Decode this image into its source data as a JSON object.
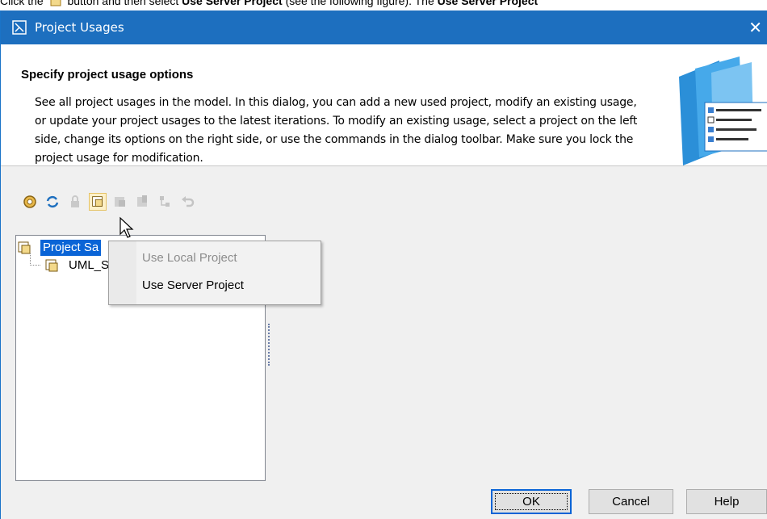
{
  "doc": {
    "prefix": "Click the",
    "middle": "button and then select",
    "bold1": "Use Server Project",
    "after": "(see the following figure). The",
    "bold2": "Use Server Project"
  },
  "window": {
    "title": "Project Usages",
    "close_glyph": "✕"
  },
  "header": {
    "title": "Specify project usage options",
    "description": "See all project usages in the model. In this dialog, you can add a new used project, modify an existing usage, or update your project usages to the latest iterations. To modify an existing usage, select a project on the left side, change its options on the right side, or use the commands in the dialog toolbar. Make sure you lock the project usage for modification."
  },
  "toolbar": {
    "icons": [
      "settings-icon",
      "refresh-icon",
      "lock-icon",
      "add-project-icon",
      "import-icon",
      "export-icon",
      "hierarchy-icon",
      "undo-icon"
    ]
  },
  "tree": {
    "items": [
      {
        "label": "Project Sa"
      },
      {
        "label": "UML_S"
      }
    ]
  },
  "menu": {
    "items": [
      {
        "label": "Use Local Project",
        "enabled": false
      },
      {
        "label": "Use Server Project",
        "enabled": true
      }
    ]
  },
  "buttons": {
    "ok": "OK",
    "cancel": "Cancel",
    "help": "Help"
  },
  "colors": {
    "titlebar": "#1d6fbf",
    "selection": "#0a64d6",
    "body": "#f0f0f0"
  }
}
